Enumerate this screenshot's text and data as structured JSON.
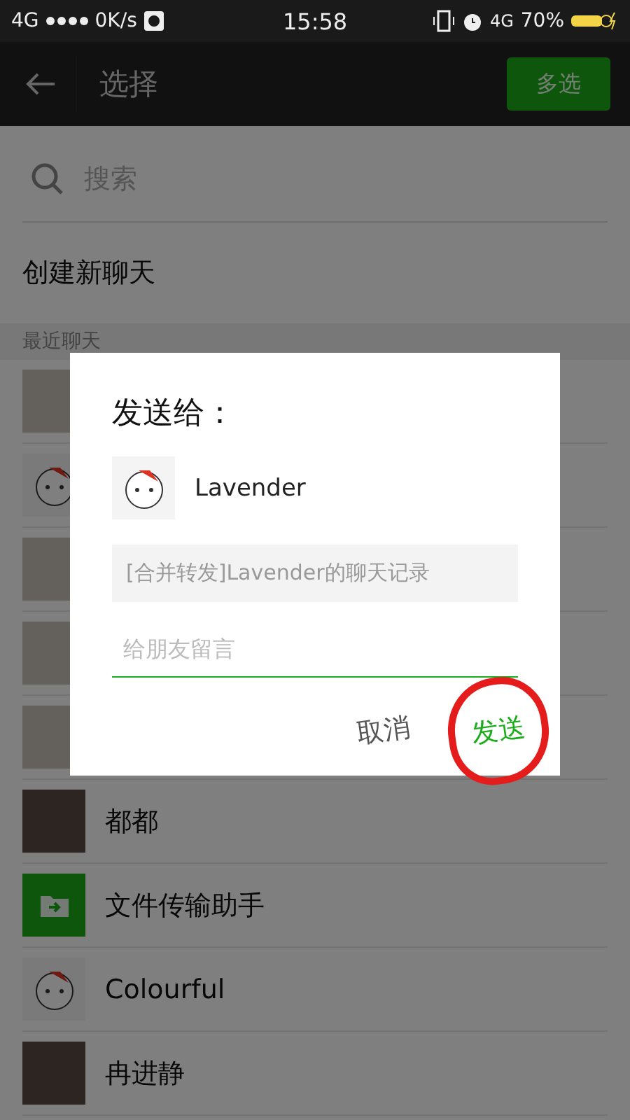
{
  "status_bar": {
    "network": "4G",
    "speed": "0K/s",
    "time": "15:58",
    "network_right": "4G",
    "battery": "70%"
  },
  "header": {
    "title": "选择",
    "action": "多选"
  },
  "search": {
    "placeholder": "搜索"
  },
  "new_chat": "创建新聊天",
  "section_label": "最近聊天",
  "chats": [
    {
      "kind": "group"
    },
    {
      "kind": "cartoon"
    },
    {
      "kind": "group"
    },
    {
      "kind": "group"
    },
    {
      "kind": "group"
    },
    {
      "kind": "photo",
      "name": "都都"
    },
    {
      "kind": "file",
      "name": "文件传输助手"
    },
    {
      "kind": "cartoon",
      "name": "Colourful"
    },
    {
      "kind": "photo",
      "name": "冉进静"
    }
  ],
  "dialog": {
    "title": "发送给：",
    "recipient": "Lavender",
    "preview": "[合并转发]Lavender的聊天记录",
    "message": {
      "placeholder": "给朋友留言"
    },
    "buttons": [
      {
        "label": "取消",
        "kind": "cancel",
        "circled": false
      },
      {
        "label": "发送",
        "kind": "send",
        "circled": true
      }
    ]
  }
}
